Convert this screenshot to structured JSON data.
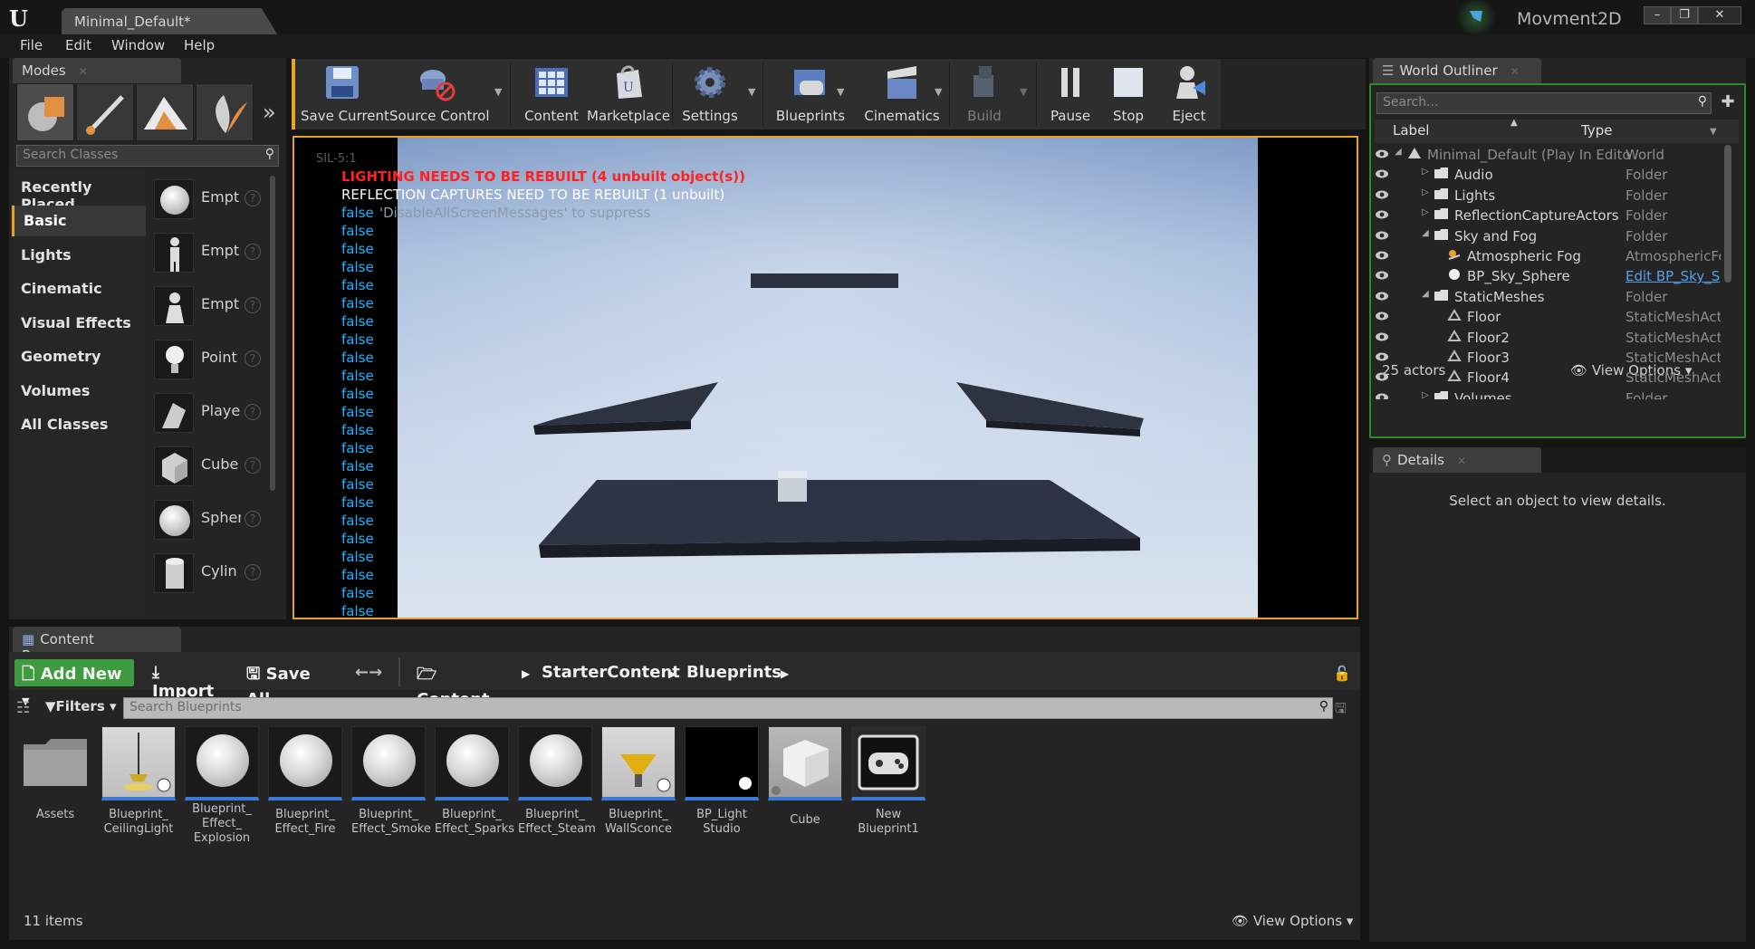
{
  "window": {
    "doc_tab": "Minimal_Default*",
    "project": "Movment2D",
    "min": "–",
    "restore": "❐",
    "close": "✕"
  },
  "menu": [
    "File",
    "Edit",
    "Window",
    "Help"
  ],
  "modes": {
    "tab": "Modes",
    "search_placeholder": "Search Classes",
    "categories": [
      "Recently Placed",
      "Basic",
      "Lights",
      "Cinematic",
      "Visual Effects",
      "Geometry",
      "Volumes",
      "All Classes"
    ],
    "items": [
      "Empt",
      "Empt",
      "Empt",
      "Point",
      "Playe",
      "Cube",
      "Spher",
      "Cylin"
    ],
    "help_glyph": "?"
  },
  "toolbar": [
    "Save Current",
    "Source Control",
    "Content",
    "Marketplace",
    "Settings",
    "Blueprints",
    "Cinematics",
    "Build",
    "Pause",
    "Stop",
    "Eject"
  ],
  "viewport": {
    "overlay_tag": "SIL-5:1",
    "msg_lighting": "LIGHTING NEEDS TO BE REBUILT (4 unbuilt object(s))",
    "msg_reflection": "REFLECTION CAPTURES NEED TO BE REBUILT (1 unbuilt)",
    "msg_suppress": "'DisableAllScreenMessages' to suppress",
    "false_text": "false"
  },
  "outliner": {
    "tab": "World Outliner",
    "search_placeholder": "Search...",
    "col_label": "Label",
    "col_type": "Type",
    "rows": [
      {
        "label": "Minimal_Default (Play In Edito",
        "type": "World"
      },
      {
        "label": "Audio",
        "type": "Folder"
      },
      {
        "label": "Lights",
        "type": "Folder"
      },
      {
        "label": "ReflectionCaptureActors",
        "type": "Folder"
      },
      {
        "label": "Sky and Fog",
        "type": "Folder"
      },
      {
        "label": "Atmospheric Fog",
        "type": "AtmosphericFo"
      },
      {
        "label": "BP_Sky_Sphere",
        "type": "Edit BP_Sky_S"
      },
      {
        "label": "StaticMeshes",
        "type": "Folder"
      },
      {
        "label": "Floor",
        "type": "StaticMeshActo"
      },
      {
        "label": "Floor2",
        "type": "StaticMeshActo"
      },
      {
        "label": "Floor3",
        "type": "StaticMeshActo"
      },
      {
        "label": "Floor4",
        "type": "StaticMeshActo"
      },
      {
        "label": "Volumes",
        "type": "Folder"
      }
    ],
    "actor_count": "25 actors",
    "view_options": "View Options"
  },
  "details": {
    "tab": "Details",
    "empty_msg": "Select an object to view details."
  },
  "content_browser": {
    "tab": "Content Browser",
    "add_new": "Add New",
    "import": "Import",
    "save_all": "Save All",
    "path": [
      "Content",
      "StarterContent",
      "Blueprints"
    ],
    "filters": "Filters",
    "search_placeholder": "Search Blueprints",
    "assets": [
      {
        "name": "Assets"
      },
      {
        "name": "Blueprint_ CeilingLight"
      },
      {
        "name": "Blueprint_ Effect_ Explosion"
      },
      {
        "name": "Blueprint_ Effect_Fire"
      },
      {
        "name": "Blueprint_ Effect_Smoke"
      },
      {
        "name": "Blueprint_ Effect_Sparks"
      },
      {
        "name": "Blueprint_ Effect_Steam"
      },
      {
        "name": "Blueprint_ WallSconce"
      },
      {
        "name": "BP_Light Studio"
      },
      {
        "name": "Cube"
      },
      {
        "name": "New Blueprint1"
      }
    ],
    "item_count": "11 items",
    "view_options": "View Options"
  },
  "colors": {
    "accent": "#e6a324",
    "add_new": "#3f9b3f",
    "error": "#ff2020",
    "info_blue": "#1ab5ff",
    "selection": "#3c78d8"
  }
}
